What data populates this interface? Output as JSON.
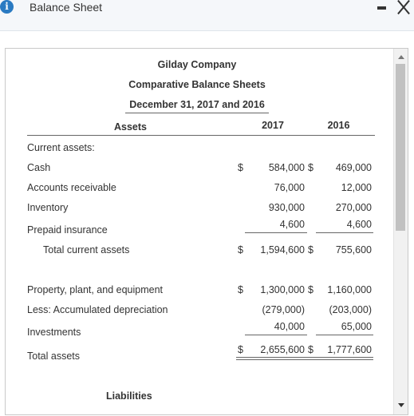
{
  "window": {
    "title": "Balance Sheet",
    "info_icon": "i"
  },
  "report": {
    "company": "Gilday Company",
    "title": "Comparative Balance Sheets",
    "date": "December 31, 2017 and 2016",
    "assets_header": "Assets",
    "years": [
      "2017",
      "2016"
    ],
    "current_assets_label": "Current assets:",
    "rows": {
      "cash": {
        "label": "Cash",
        "cur1": "$",
        "v2017": "584,000",
        "cur2": "$",
        "v2016": "469,000"
      },
      "ar": {
        "label": "Accounts receivable",
        "v2017": "76,000",
        "v2016": "12,000"
      },
      "inventory": {
        "label": "Inventory",
        "v2017": "930,000",
        "v2016": "270,000"
      },
      "prepaid": {
        "label": "Prepaid insurance",
        "v2017": "4,600",
        "v2016": "4,600"
      },
      "total_current": {
        "label": "Total current assets",
        "cur1": "$",
        "v2017": "1,594,600",
        "cur2": "$",
        "v2016": "755,600"
      },
      "ppe": {
        "label": "Property, plant, and equipment",
        "cur1": "$",
        "v2017": "1,300,000",
        "cur2": "$",
        "v2016": "1,160,000"
      },
      "accum": {
        "label": "Less: Accumulated depreciation",
        "v2017": "(279,000)",
        "v2016": "(203,000)"
      },
      "investments": {
        "label": "Investments",
        "v2017": "40,000",
        "v2016": "65,000"
      },
      "total_assets": {
        "label": "Total assets",
        "cur1": "$",
        "v2017": "2,655,600",
        "cur2": "$",
        "v2016": "1,777,600"
      }
    },
    "liabilities_header": "Liabilities"
  }
}
